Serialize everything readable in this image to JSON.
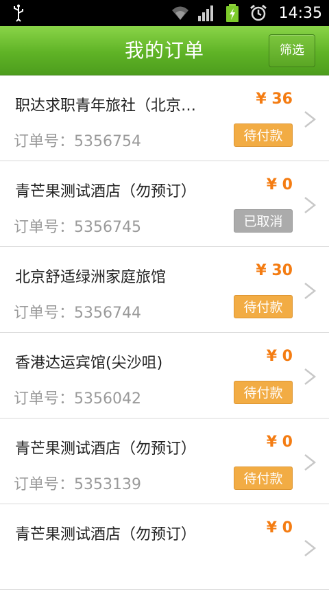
{
  "status_bar": {
    "time": "14:35",
    "icons": [
      "usb-icon",
      "wifi-icon",
      "signal-icon",
      "battery-charging-icon",
      "alarm-icon"
    ]
  },
  "header": {
    "title": "我的订单",
    "filter_label": "筛选"
  },
  "colors": {
    "accent_green": "#5fb326",
    "price_orange": "#f47c12",
    "badge_pending": "#f2ac44",
    "badge_cancelled": "#ababab"
  },
  "orders": [
    {
      "hotel": "职达求职青年旅社（北京…",
      "price": "¥ 36",
      "order_no": "订单号：5356754",
      "status": "待付款",
      "status_type": "pending"
    },
    {
      "hotel": "青芒果测试酒店（勿预订）",
      "price": "¥ 0",
      "order_no": "订单号：5356745",
      "status": "已取消",
      "status_type": "cancel"
    },
    {
      "hotel": "北京舒适绿洲家庭旅馆",
      "price": "¥ 30",
      "order_no": "订单号：5356744",
      "status": "待付款",
      "status_type": "pending"
    },
    {
      "hotel": "香港达运宾馆(尖沙咀)",
      "price": "¥ 0",
      "order_no": "订单号：5356042",
      "status": "待付款",
      "status_type": "pending"
    },
    {
      "hotel": "青芒果测试酒店（勿预订）",
      "price": "¥ 0",
      "order_no": "订单号：5353139",
      "status": "待付款",
      "status_type": "pending"
    },
    {
      "hotel": "青芒果测试酒店（勿预订）",
      "price": "¥ 0",
      "order_no": "",
      "status": "",
      "status_type": ""
    }
  ]
}
